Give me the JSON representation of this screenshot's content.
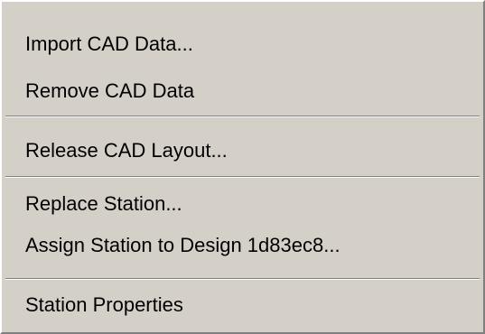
{
  "context_menu": {
    "items": [
      {
        "label": "Import CAD Data..."
      },
      {
        "label": "Remove CAD Data"
      },
      {
        "label": "Release CAD Layout..."
      },
      {
        "label": "Replace Station..."
      },
      {
        "label": "Assign Station to Design 1d83ec8..."
      },
      {
        "label": "Station Properties"
      }
    ]
  }
}
